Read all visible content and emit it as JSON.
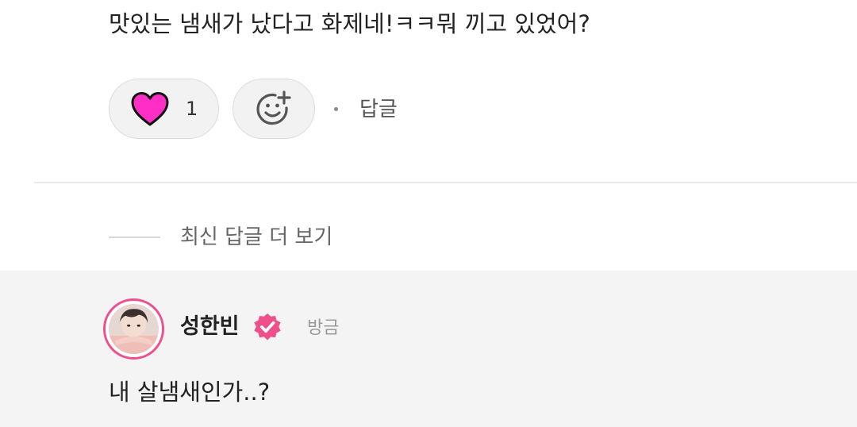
{
  "comment": {
    "text": "맛있는 냄새가 났다고 화제네!ㅋㅋ뭐 끼고 있었어?"
  },
  "actions": {
    "like_icon": "heart-icon",
    "like_count": "1",
    "reaction_icon": "add-reaction-icon",
    "reply_label": "답글"
  },
  "more_replies": {
    "label": "최신 답글 더 보기"
  },
  "reply": {
    "username": "성한빈",
    "verified_icon": "verified-badge-icon",
    "time": "방금",
    "text": "내 살냄새인가..?"
  },
  "colors": {
    "heart": "#ff2ec4",
    "accent": "#ef4f8b",
    "reply_background": "#f4f4f4"
  }
}
